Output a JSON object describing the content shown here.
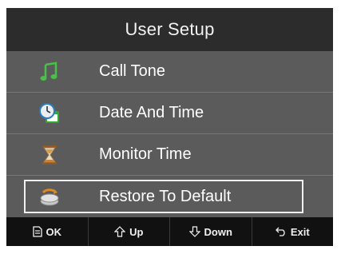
{
  "header": {
    "title": "User Setup"
  },
  "menu": {
    "items": [
      {
        "label": "Call Tone",
        "icon": "music-note-icon"
      },
      {
        "label": "Date And Time",
        "icon": "clock-calendar-icon"
      },
      {
        "label": "Monitor Time",
        "icon": "hourglass-icon"
      },
      {
        "label": "Restore To Default",
        "icon": "restore-icon",
        "selected": true
      }
    ]
  },
  "softkeys": {
    "ok": "OK",
    "up": "Up",
    "down": "Down",
    "exit": "Exit"
  },
  "colors": {
    "title_bar": "#2c2c2c",
    "menu_background": "#5b5b5b",
    "softkey_bar": "#111111",
    "icon_green": "#3fbf3f"
  }
}
